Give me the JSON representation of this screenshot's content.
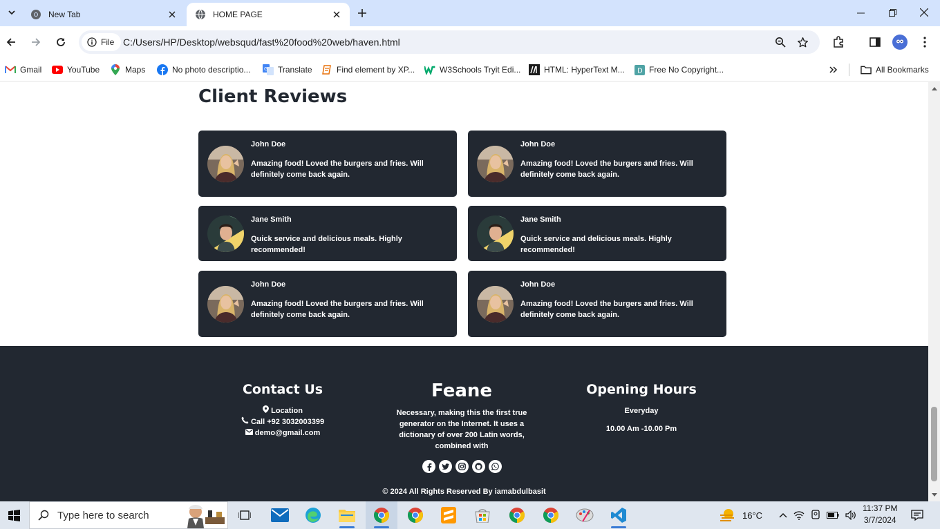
{
  "browser": {
    "tabs": [
      {
        "title": "New Tab"
      },
      {
        "title": "HOME PAGE"
      }
    ],
    "site_chip": "File",
    "url": "C:/Users/HP/Desktop/websqud/fast%20food%20web/haven.html",
    "bookmarks": [
      {
        "label": "Gmail"
      },
      {
        "label": "YouTube"
      },
      {
        "label": "Maps"
      },
      {
        "label": "No photo descriptio..."
      },
      {
        "label": "Translate"
      },
      {
        "label": "Find element by XP..."
      },
      {
        "label": "W3Schools Tryit Edi..."
      },
      {
        "label": "HTML: HyperText M..."
      },
      {
        "label": "Free No Copyright..."
      }
    ],
    "all_bookmarks": "All Bookmarks"
  },
  "page": {
    "reviews_title": "Client Reviews",
    "reviews": [
      {
        "name": "John Doe",
        "text": "Amazing food! Loved the burgers and fries. Will definitely come back again.",
        "avatar": "woman-avatar"
      },
      {
        "name": "John Doe",
        "text": "Amazing food! Loved the burgers and fries. Will definitely come back again.",
        "avatar": "woman-avatar"
      },
      {
        "name": "Jane Smith",
        "text": "Quick service and delicious meals. Highly recommended!",
        "avatar": "man-avatar"
      },
      {
        "name": "Jane Smith",
        "text": "Quick service and delicious meals. Highly recommended!",
        "avatar": "man-avatar"
      },
      {
        "name": "John Doe",
        "text": "Amazing food! Loved the burgers and fries. Will definitely come back again.",
        "avatar": "woman-avatar"
      },
      {
        "name": "John Doe",
        "text": "Amazing food! Loved the burgers and fries. Will definitely come back again.",
        "avatar": "woman-avatar"
      }
    ],
    "footer": {
      "contact_heading": "Contact Us",
      "location": "Location",
      "phone": "Call +92 3032003399",
      "email": "demo@gmail.com",
      "brand": "Feane",
      "brand_text": "Necessary, making this the first true generator on the Internet. It uses a dictionary of over 200 Latin words, combined with",
      "hours_heading": "Opening Hours",
      "hours_days": "Everyday",
      "hours_time": "10.00 Am -10.00 Pm",
      "copyright": "© 2024 All Rights Reserved By iamabdulbasit",
      "social": [
        "facebook-icon",
        "twitter-icon",
        "instagram-icon",
        "github-icon",
        "whatsapp-icon"
      ]
    }
  },
  "taskbar": {
    "search_placeholder": "Type here to search",
    "weather": "16°C",
    "time": "11:37 PM",
    "date": "3/7/2024"
  },
  "colors": {
    "tabstrip": "#d3e3fd",
    "card": "#222831",
    "footer": "#222831"
  }
}
